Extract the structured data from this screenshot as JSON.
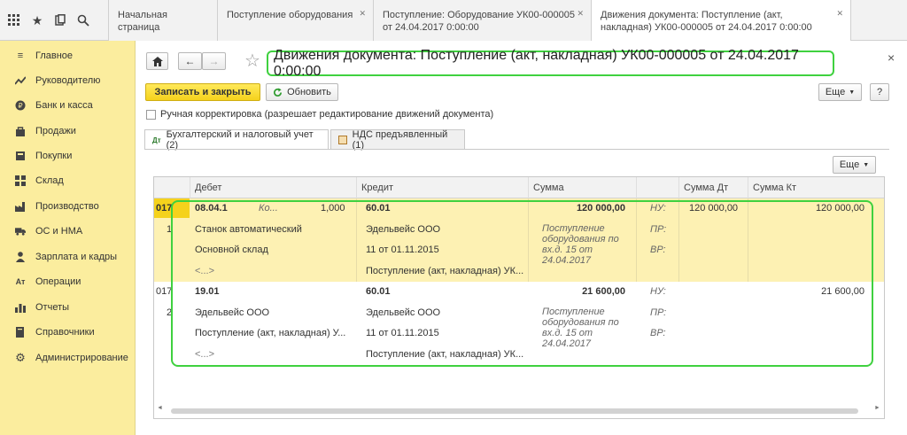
{
  "tabs": [
    {
      "label": "Начальная страница"
    },
    {
      "label": "Поступление оборудования"
    },
    {
      "label": "Поступление: Оборудование УК00-000005 от 24.04.2017 0:00:00"
    },
    {
      "label": "Движения документа: Поступление (акт, накладная) УК00-000005 от 24.04.2017 0:00:00"
    }
  ],
  "sidebar": {
    "items": [
      {
        "label": "Главное",
        "icon": "menu-icon"
      },
      {
        "label": "Руководителю",
        "icon": "trend-icon"
      },
      {
        "label": "Банк и касса",
        "icon": "ruble-icon"
      },
      {
        "label": "Продажи",
        "icon": "bag-icon"
      },
      {
        "label": "Покупки",
        "icon": "cart-icon"
      },
      {
        "label": "Склад",
        "icon": "grid-icon"
      },
      {
        "label": "Производство",
        "icon": "factory-icon"
      },
      {
        "label": "ОС и НМА",
        "icon": "truck-icon"
      },
      {
        "label": "Зарплата и кадры",
        "icon": "person-icon"
      },
      {
        "label": "Операции",
        "icon": "ops-icon"
      },
      {
        "label": "Отчеты",
        "icon": "chart-icon"
      },
      {
        "label": "Справочники",
        "icon": "book-icon"
      },
      {
        "label": "Администрирование",
        "icon": "gear-icon"
      }
    ]
  },
  "header": {
    "title": "Движения документа: Поступление (акт, накладная) УК00-000005 от 24.04.2017 0:00:00",
    "close": "×"
  },
  "toolbar": {
    "save_close": "Записать и закрыть",
    "refresh": "Обновить",
    "more": "Еще",
    "help": "?"
  },
  "manual_edit": {
    "label": "Ручная корректировка (разрешает редактирование движений документа)",
    "checked": false
  },
  "subtabs": [
    {
      "label": "Бухгалтерский и налоговый учет (2)"
    },
    {
      "label": "НДС предъявленный (1)"
    }
  ],
  "table": {
    "more": "Еще",
    "columns": [
      "Дебет",
      "Кредит",
      "Сумма",
      "Сумма Дт",
      "Сумма Кт"
    ],
    "rows": [
      {
        "period": "017",
        "num": "1",
        "debit_account": "08.04.1",
        "debit_qty_label": "Ко...",
        "debit_qty": "1,000",
        "debit_sub1": "Станок автоматический",
        "debit_sub2": "Основной склад",
        "debit_sub3": "<...>",
        "credit_account": "60.01",
        "credit_sub1": "Эдельвейс ООО",
        "credit_sub2": "11 от 01.11.2015",
        "credit_sub3": "Поступление (акт, накладная) УК...",
        "amount": "120 000,00",
        "content": "Поступление оборудования по вх.д. 15 от 24.04.2017",
        "nu": "НУ:",
        "pr": "ПР:",
        "vr": "ВР:",
        "sum_dt": "120 000,00",
        "sum_kt": "120 000,00"
      },
      {
        "period": "017",
        "num": "2",
        "debit_account": "19.01",
        "debit_sub1": "Эдельвейс ООО",
        "debit_sub2": "Поступление (акт, накладная) У...",
        "debit_sub3": "<...>",
        "credit_account": "60.01",
        "credit_sub1": "Эдельвейс ООО",
        "credit_sub2": "11 от 01.11.2015",
        "credit_sub3": "Поступление (акт, накладная) УК...",
        "amount": "21 600,00",
        "content": "Поступление оборудования по вх.д. 15 от 24.04.2017",
        "nu": "НУ:",
        "pr": "ПР:",
        "vr": "ВР:",
        "sum_dt": "",
        "sum_kt": "21 600,00"
      }
    ]
  },
  "colors": {
    "sidebar_bg": "#fbed9e",
    "selected_row_bg": "#fdf1b3",
    "highlight_border": "#3fd13f",
    "primary_button": "#f5d21c"
  }
}
